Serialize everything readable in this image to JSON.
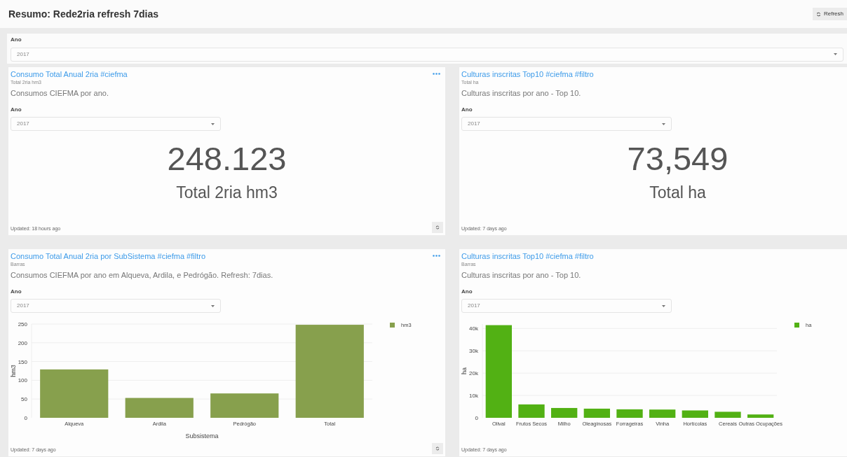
{
  "header": {
    "title": "Resumo: Rede2ria refresh 7dias",
    "refresh_button": "Refresh"
  },
  "filter": {
    "label": "Ano",
    "value": "2017"
  },
  "widgets": [
    {
      "kind": "counter",
      "title": "Consumo Total Anual 2ria #ciefma",
      "subtitle": "Total 2ria hm3",
      "description": "Consumos CIEFMA por ano.",
      "filter": {
        "label": "Ano",
        "value": "2017"
      },
      "value": "248.123",
      "value_label": "Total 2ria hm3",
      "updated": "Updated: 18 hours ago",
      "menu": true,
      "refresh_control": true
    },
    {
      "kind": "counter",
      "title": "Culturas inscritas Top10 #ciefma #filtro",
      "subtitle": "Total ha",
      "description": "Culturas inscritas por ano - Top 10.",
      "filter": {
        "label": "Ano",
        "value": "2017"
      },
      "value": "73,549",
      "value_label": "Total ha",
      "updated": "Updated: 7 days ago",
      "menu": false,
      "refresh_control": false
    },
    {
      "kind": "chart",
      "title": "Consumo Total Anual 2ria por SubSistema #ciefma #filtro",
      "subtitle": "Barras",
      "description": "Consumos CIEFMA por ano em Alqueva, Ardila, e Pedrógão. Refresh: 7dias.",
      "filter": {
        "label": "Ano",
        "value": "2017"
      },
      "updated": "Updated: 7 days ago",
      "menu": true,
      "refresh_control": true,
      "chart_data": {
        "type": "bar",
        "xlabel": "Subsistema",
        "ylabel": "hm3",
        "categories": [
          "Alqueva",
          "Ardila",
          "Pedrógão",
          "Total"
        ],
        "series": [
          {
            "name": "hm3",
            "color": "#87a04d",
            "values": [
              129,
              53,
              65,
              248
            ]
          }
        ],
        "grid": true,
        "ylim": [
          0,
          250
        ],
        "yticks": [
          0,
          50,
          100,
          150,
          200,
          250
        ]
      }
    },
    {
      "kind": "chart",
      "title": "Culturas inscritas Top10 #ciefma #filtro",
      "subtitle": "Barras",
      "description": "Culturas inscritas por ano - Top 10.",
      "filter": {
        "label": "Ano",
        "value": "2017"
      },
      "updated": "Updated: 7 days ago",
      "menu": false,
      "refresh_control": false,
      "chart_data": {
        "type": "bar",
        "ylabel": "ha",
        "categories": [
          "Olival",
          "Frutos Secos",
          "Milho",
          "Oleaginosas",
          "Forrageiras",
          "Vinha",
          "Hortícolas",
          "Cereais",
          "Outras Ocupações"
        ],
        "series": [
          {
            "name": "ha",
            "color": "#52b114",
            "values": [
              41500,
              6000,
              4400,
              4100,
              3800,
              3700,
              3300,
              2700,
              1500
            ]
          }
        ],
        "grid": true,
        "ylim": [
          0,
          42000
        ],
        "yticks": [
          0,
          {
            "value": 10000,
            "label": "10k"
          },
          {
            "value": 20000,
            "label": "20k"
          },
          {
            "value": 30000,
            "label": "30k"
          },
          {
            "value": 40000,
            "label": "40k"
          }
        ]
      }
    }
  ]
}
